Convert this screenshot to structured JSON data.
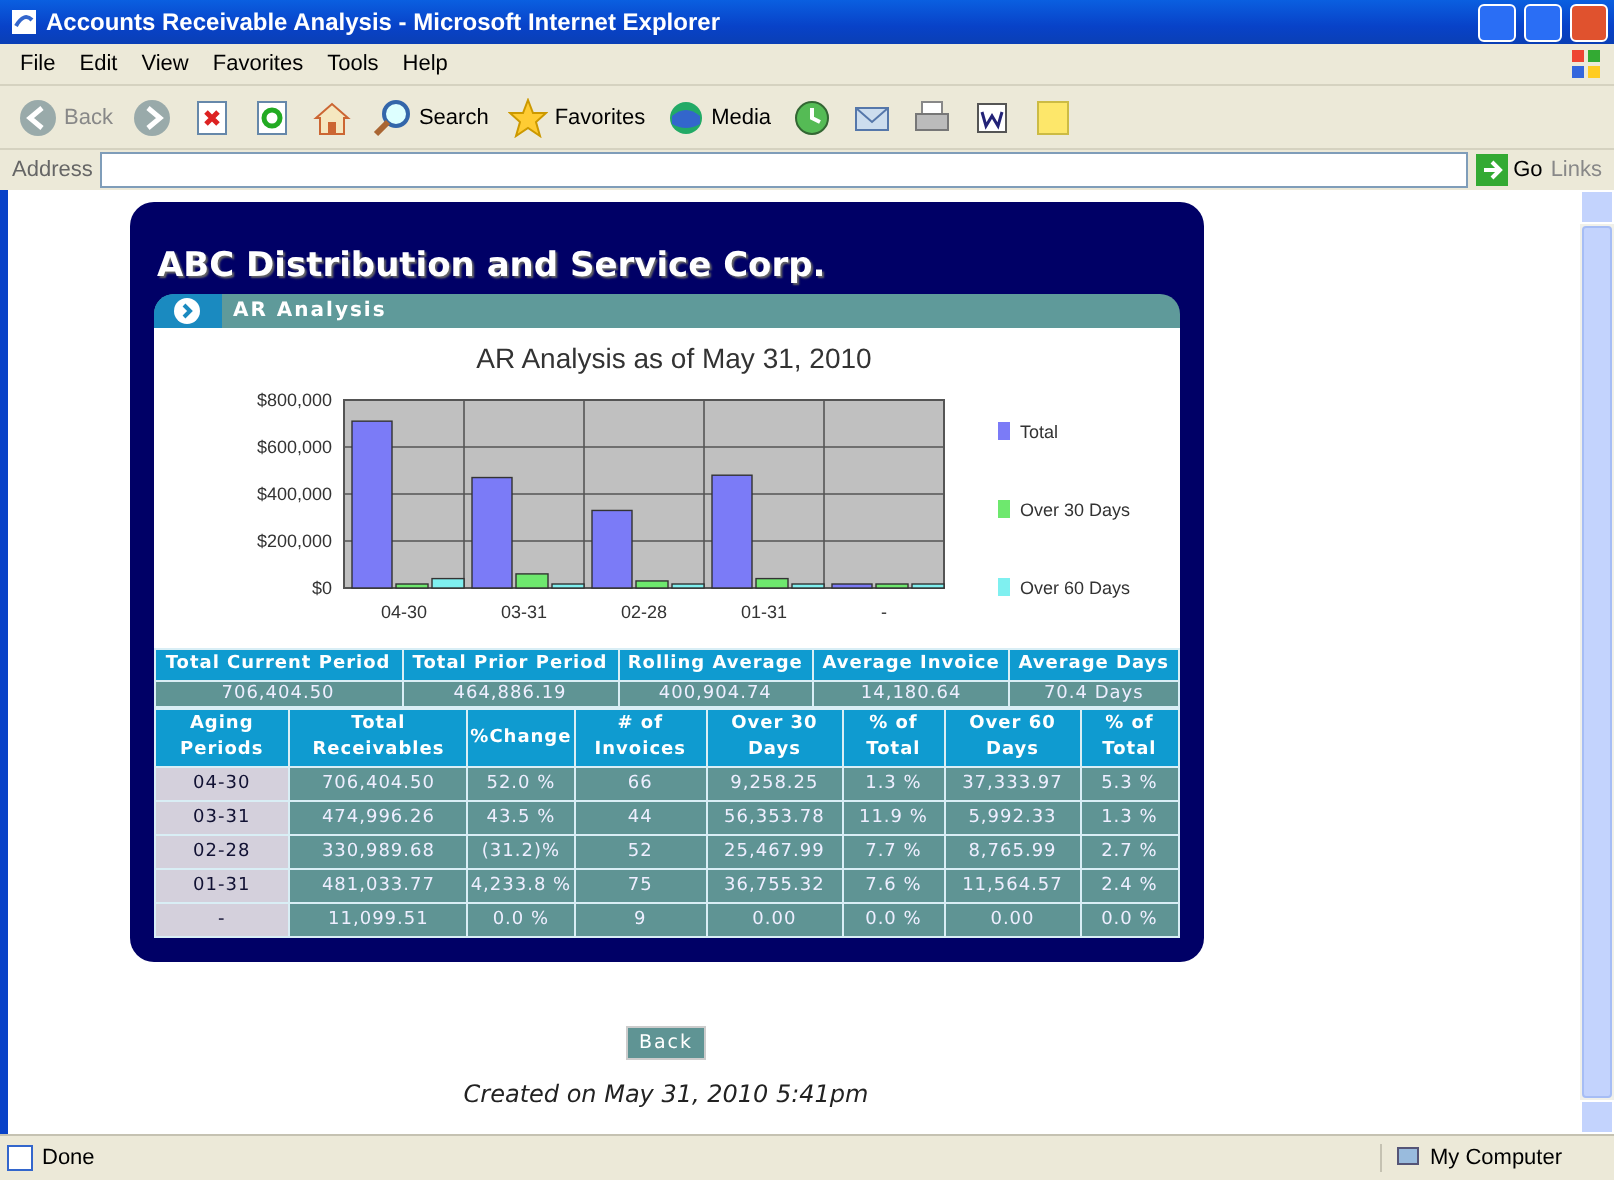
{
  "window": {
    "title": "Accounts Receivable Analysis - Microsoft Internet Explorer"
  },
  "menu": [
    "File",
    "Edit",
    "View",
    "Favorites",
    "Tools",
    "Help"
  ],
  "toolbar": [
    {
      "kind": "back",
      "label": "Back"
    },
    {
      "kind": "forward"
    },
    {
      "kind": "stop"
    },
    {
      "kind": "refresh"
    },
    {
      "kind": "home"
    },
    {
      "kind": "search",
      "label": "Search"
    },
    {
      "kind": "favorites",
      "label": "Favorites"
    },
    {
      "kind": "media",
      "label": "Media"
    },
    {
      "kind": "history"
    },
    {
      "kind": "mail"
    },
    {
      "kind": "print"
    },
    {
      "kind": "word"
    },
    {
      "kind": "note"
    }
  ],
  "address_bar": {
    "label": "Address",
    "go": "Go",
    "links": "Links"
  },
  "page": {
    "company": "ABC Distribution and Service Corp.",
    "section": "AR Analysis",
    "chart": {
      "chart_data": {
        "type": "bar",
        "title": "AR Analysis as of May 31, 2010",
        "categories": [
          "04-30",
          "03-31",
          "02-28",
          "01-31",
          "-"
        ],
        "ylim": [
          0,
          800000
        ],
        "yticks": [
          {
            "value": 0,
            "label": "$0"
          },
          {
            "value": 200000,
            "label": "$200,000"
          },
          {
            "value": 400000,
            "label": "$400,000"
          },
          {
            "value": 600000,
            "label": "$600,000"
          },
          {
            "value": 800000,
            "label": "$800,000"
          }
        ],
        "grid": true,
        "legend": true,
        "series": [
          {
            "name": "Total",
            "color": "#7b7bf7",
            "values": [
              710000,
              470000,
              330000,
              480000,
              10000
            ]
          },
          {
            "name": "Over 30 Days",
            "color": "#6ee86e",
            "values": [
              10000,
              60000,
              30000,
              40000,
              0
            ]
          },
          {
            "name": "Over 60 Days",
            "color": "#7ff0f0",
            "values": [
              40000,
              10000,
              10000,
              10000,
              0
            ]
          }
        ]
      }
    },
    "summary": {
      "columns": [
        "Total Current Period",
        "Total Prior Period",
        "Rolling Average",
        "Average Invoice",
        "Average Days"
      ],
      "values": [
        "706,404.50",
        "464,886.19",
        "400,904.74",
        "14,180.64",
        "70.4 Days"
      ]
    },
    "aging": {
      "columns": [
        "Aging Periods",
        "Total Receivables",
        "%Change",
        "# of Invoices",
        "Over 30 Days",
        "% of Total",
        "Over 60 Days",
        "% of Total"
      ],
      "rows": [
        [
          "04-30",
          "706,404.50",
          "52.0 %",
          "66",
          "9,258.25",
          "1.3 %",
          "37,333.97",
          "5.3 %"
        ],
        [
          "03-31",
          "474,996.26",
          "43.5 %",
          "44",
          "56,353.78",
          "11.9 %",
          "5,992.33",
          "1.3 %"
        ],
        [
          "02-28",
          "330,989.68",
          "(31.2)%",
          "52",
          "25,467.99",
          "7.7 %",
          "8,765.99",
          "2.7 %"
        ],
        [
          "01-31",
          "481,033.77",
          "4,233.8 %",
          "75",
          "36,755.32",
          "7.6 %",
          "11,564.57",
          "2.4 %"
        ],
        [
          "-",
          "11,099.51",
          "0.0 %",
          "9",
          "0.00",
          "0.0 %",
          "0.00",
          "0.0 %"
        ]
      ]
    },
    "back_button": "Back",
    "footer": "Created on May 31, 2010 5:41pm"
  },
  "status_bar": {
    "text": "Done",
    "zone": "My Computer"
  }
}
